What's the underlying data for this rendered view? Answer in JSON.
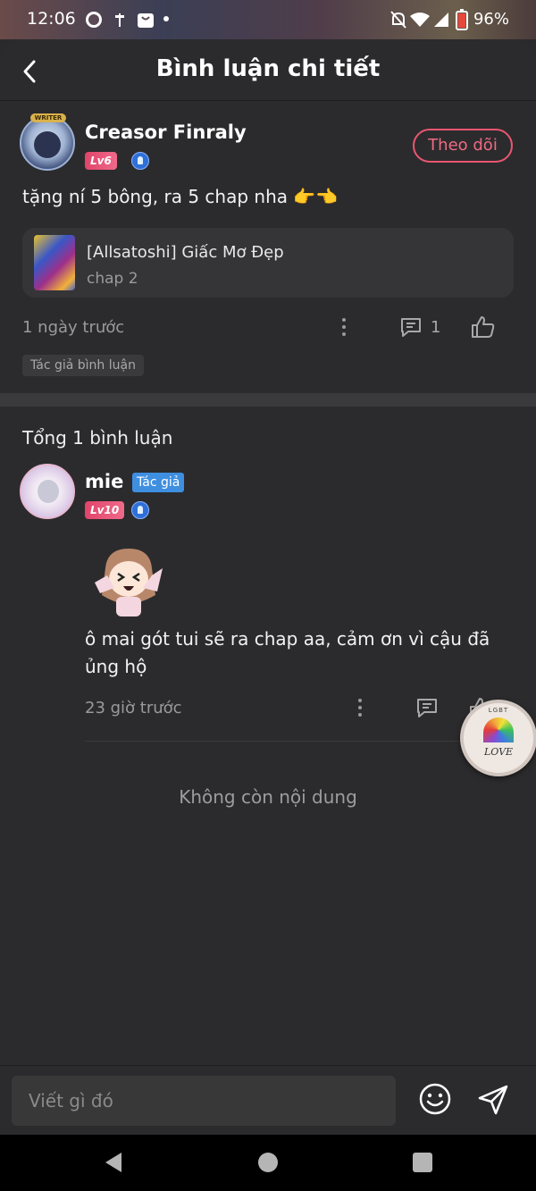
{
  "status_bar": {
    "time": "12:06",
    "battery": "96%",
    "left_icons": [
      "whatsapp-icon",
      "usb-icon",
      "shopee-icon",
      "notification-dot-icon"
    ],
    "right_icons": [
      "mute-icon",
      "wifi-icon",
      "signal-icon",
      "battery-icon"
    ]
  },
  "header": {
    "title": "Bình luận chi tiết",
    "back_icon": "back-arrow-icon"
  },
  "comment": {
    "username": "Creasor Finraly",
    "avatar_tag": "WRITER",
    "level": "Lv6",
    "follow_label": "Theo dõi",
    "text": "tặng ní 5 bông, ra 5 chap nha 👉👈",
    "story": {
      "title": "[Allsatoshi] Giấc Mơ Đẹp",
      "chapter": "chap 2"
    },
    "time": "1 ngày trước",
    "reply_count": "1",
    "author_tag": "Tác giả bình luận"
  },
  "replies_section": {
    "total_label": "Tổng 1 bình luận",
    "reply": {
      "username": "mie",
      "author_badge": "Tác giả",
      "level": "Lv10",
      "text": "ô mai gót tui sẽ ra chap aa, cảm ơn vì cậu đã ủng hộ",
      "time": "23 giờ trước"
    },
    "empty_label": "Không còn nội dung"
  },
  "floating_badge": {
    "top_text": "LGBT",
    "label": "LOVE"
  },
  "composer": {
    "placeholder": "Viết gì đó"
  },
  "colors": {
    "accent": "#e95671",
    "panel": "#2b2b2d",
    "author_blue": "#3f8fe0"
  }
}
